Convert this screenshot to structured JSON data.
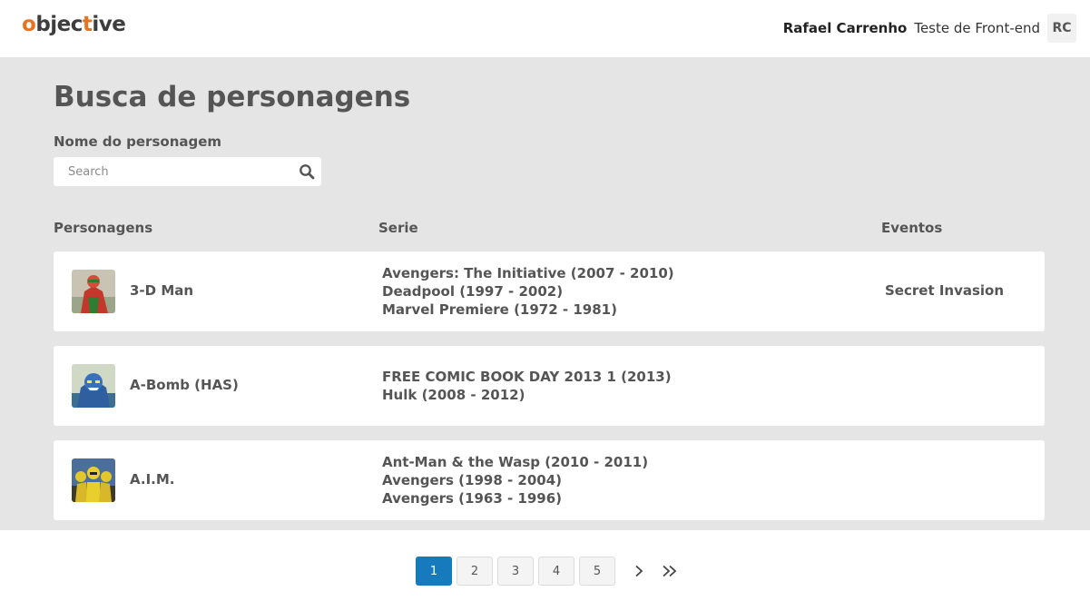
{
  "header": {
    "logo_prefix": "o",
    "logo_rest": "bjec",
    "logo_accent2": "t",
    "logo_end": "ive",
    "user_name": "Rafael Carrenho",
    "user_role": "Teste de Front-end",
    "avatar_initials": "RC"
  },
  "main": {
    "title": "Busca de personagens",
    "search_label": "Nome do personagem",
    "search_placeholder": "Search",
    "columns": {
      "characters": "Personagens",
      "series": "Serie",
      "events": "Eventos"
    }
  },
  "rows": [
    {
      "name": "3-D Man",
      "series": [
        "Avengers: The Initiative (2007 - 2010)",
        "Deadpool (1997 - 2002)",
        "Marvel Premiere (1972 - 1981)"
      ],
      "events": "Secret Invasion"
    },
    {
      "name": "A-Bomb (HAS)",
      "series": [
        "FREE COMIC BOOK DAY 2013 1 (2013)",
        "Hulk (2008 - 2012)"
      ],
      "events": ""
    },
    {
      "name": "A.I.M.",
      "series": [
        "Ant-Man & the Wasp (2010 - 2011)",
        "Avengers (1998 - 2004)",
        "Avengers (1963 - 1996)"
      ],
      "events": ""
    }
  ],
  "pagination": {
    "pages": [
      "1",
      "2",
      "3",
      "4",
      "5"
    ],
    "current": "1"
  },
  "colors": {
    "accent": "#e8731c",
    "active_page": "#167abc",
    "background": "#e5e5e5"
  },
  "icons": {
    "search": "search-icon",
    "next": "chevron-right-icon",
    "last": "double-chevron-right-icon"
  }
}
